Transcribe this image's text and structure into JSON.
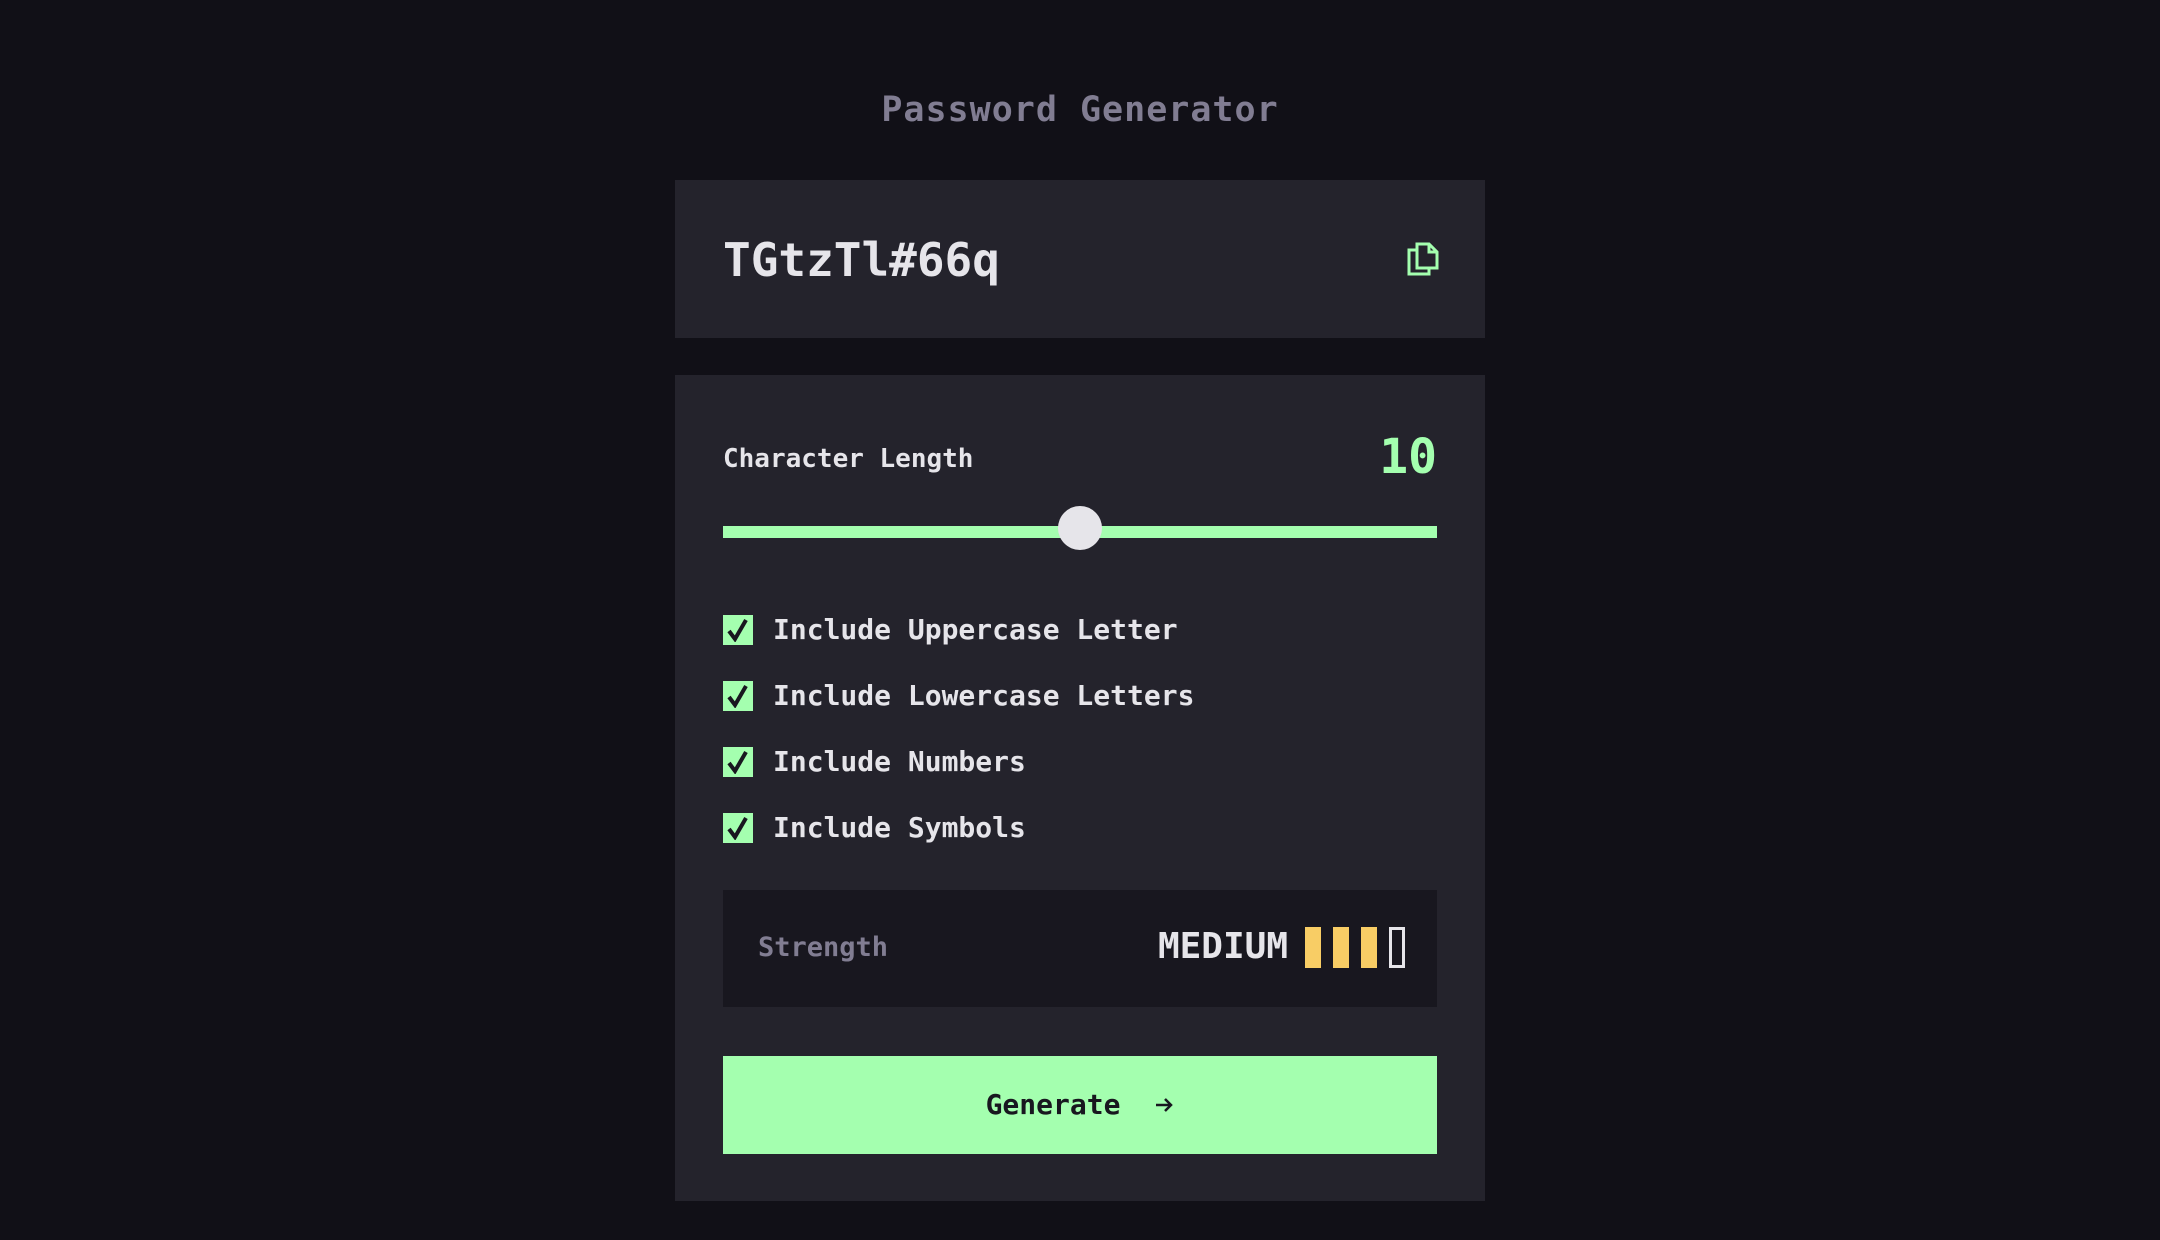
{
  "app": {
    "title": "Password Generator"
  },
  "password": {
    "value": "TGtzTl#66q",
    "copy_icon": "copy-icon"
  },
  "length": {
    "label": "Character Length",
    "value": "10",
    "slider_fraction": 0.5
  },
  "options": [
    {
      "label": "Include Uppercase Letter",
      "checked": true
    },
    {
      "label": "Include Lowercase Letters",
      "checked": true
    },
    {
      "label": "Include Numbers",
      "checked": true
    },
    {
      "label": "Include Symbols",
      "checked": true
    }
  ],
  "strength": {
    "label": "Strength",
    "value": "MEDIUM",
    "level": 3,
    "max_level": 4
  },
  "generate": {
    "label": "Generate",
    "icon": "arrow-right-icon"
  },
  "colors": {
    "accent": "#A4FFAF",
    "strength_medium": "#F8CD65",
    "panel": "#24232C",
    "background": "#111017",
    "text": "#E6E5EA",
    "muted": "#817D92"
  }
}
